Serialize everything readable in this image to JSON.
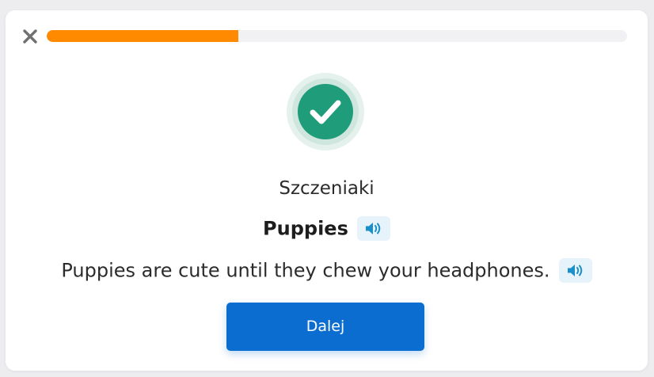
{
  "progress": {
    "value": 0.33,
    "color": "#ff8a00"
  },
  "icons": {
    "close": "close-icon",
    "status": "checkmark-icon",
    "audio": "speaker-icon"
  },
  "colors": {
    "success": "#1f9c7a",
    "primary_button": "#0b6dd0",
    "audio_icon": "#1a8fc9"
  },
  "flashcard": {
    "native_word": "Szczeniaki",
    "foreign_word": "Puppies",
    "example_sentence": "Puppies are cute until they chew your headphones."
  },
  "actions": {
    "next_label": "Dalej"
  }
}
